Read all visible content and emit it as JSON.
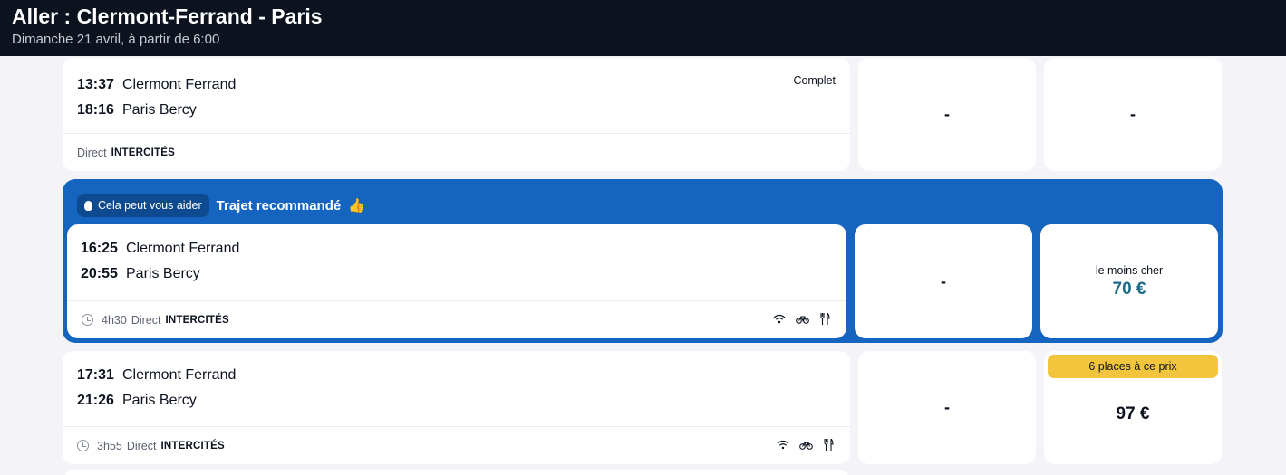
{
  "header": {
    "title": "Aller : Clermont-Ferrand - Paris",
    "subtitle": "Dimanche 21 avril, à partir de 6:00"
  },
  "trips": [
    {
      "departure_time": "13:37",
      "departure_station": "Clermont Ferrand",
      "arrival_time": "18:16",
      "arrival_station": "Paris Bercy",
      "status": "Complet",
      "connection": "Direct",
      "operator": "INTERCITÉS",
      "price_1": "-",
      "price_2": "-"
    },
    {
      "recommended": true,
      "help_label": "Cela peut vous aider",
      "recommended_label": "Trajet recommandé",
      "departure_time": "16:25",
      "departure_station": "Clermont Ferrand",
      "arrival_time": "20:55",
      "arrival_station": "Paris Bercy",
      "duration": "4h30",
      "connection": "Direct",
      "operator": "INTERCITÉS",
      "amenities": [
        "wifi-icon",
        "bike-icon",
        "restaurant-icon"
      ],
      "price_1": "-",
      "price_2_label": "le moins cher",
      "price_2": "70 €"
    },
    {
      "departure_time": "17:31",
      "departure_station": "Clermont Ferrand",
      "arrival_time": "21:26",
      "arrival_station": "Paris Bercy",
      "duration": "3h55",
      "connection": "Direct",
      "operator": "INTERCITÉS",
      "amenities": [
        "wifi-icon",
        "bike-icon",
        "restaurant-icon"
      ],
      "price_1": "-",
      "price_2_badge": "6 places à ce prix",
      "price_2": "97 €"
    }
  ],
  "colors": {
    "header_bg": "#0c131f",
    "recommended_bg": "#1565c0",
    "cheapest_price": "#1b6a88",
    "badge_bg": "#f2c53d",
    "page_bg": "#f3f3f8"
  }
}
